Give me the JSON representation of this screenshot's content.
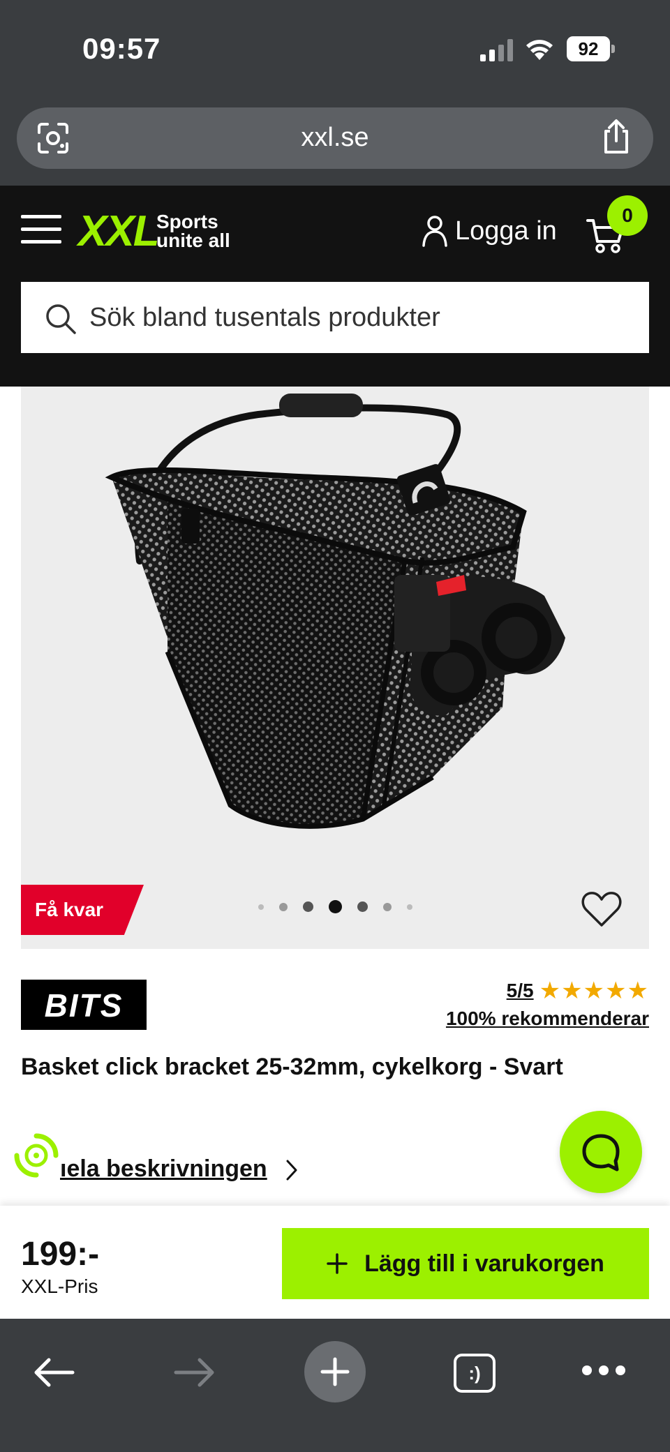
{
  "status_bar": {
    "time": "09:57",
    "battery": "92"
  },
  "browser": {
    "url": "xxl.se",
    "tabs_label": ":)"
  },
  "header": {
    "logo": "XXL",
    "tagline_line1": "Sports",
    "tagline_line2": "unite all",
    "login_label": "Logga in",
    "cart_count": "0",
    "search_placeholder": "Sök bland tusentals produkter"
  },
  "product": {
    "stock_badge": "Få kvar",
    "image_carousel": {
      "total_images": 7,
      "active_index": 3
    },
    "brand": "BITS",
    "rating_score": "5/5",
    "rating_stars": "★★★★★",
    "rating_value": 5,
    "recommend_text": "100% rekommenderar",
    "title": "Basket click bracket 25-32mm, cykelkorg - Svart",
    "description_link": "ıela beskrivningen"
  },
  "buy_bar": {
    "price": "199:-",
    "price_label": "XXL-Pris",
    "add_to_cart_label": "Lägg till i varukorgen"
  },
  "colors": {
    "brand_green": "#9cf000",
    "header_bg": "#121212",
    "badge_red": "#e1002a",
    "star_orange": "#f2a900",
    "browser_chrome": "#3a3d40"
  },
  "icons": [
    "lens-icon",
    "share-icon",
    "hamburger-icon",
    "user-icon",
    "cart-icon",
    "search-icon",
    "heart-icon",
    "chat-icon",
    "chevron-right-icon",
    "plus-icon",
    "back-arrow-icon",
    "forward-arrow-icon",
    "new-tab-plus-icon"
  ]
}
